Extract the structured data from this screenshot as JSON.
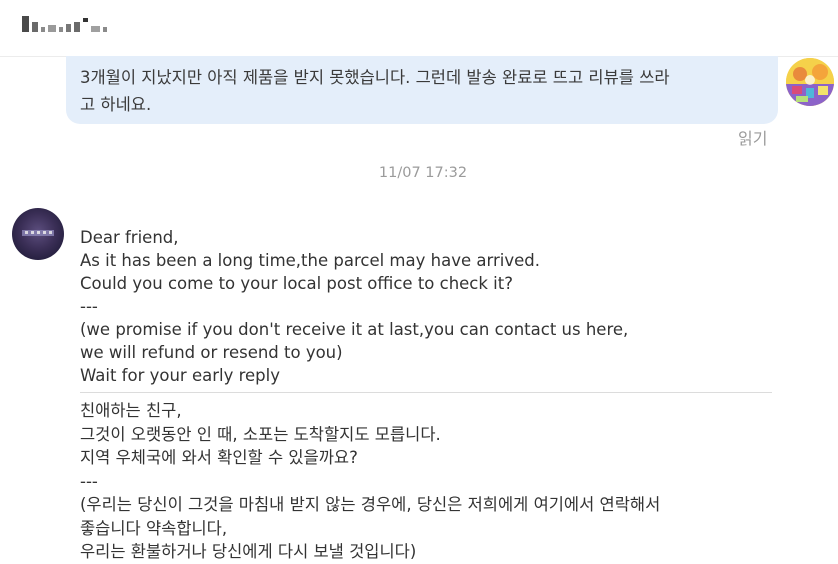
{
  "header": {
    "title_blurred": true
  },
  "outgoing_message": {
    "line1": "3개월이 지났지만 아직 제품을 받지 못했습니다. 그런데 발송 완료로 뜨고 리뷰를 쓰라",
    "line2": "고 하네요.",
    "read_status": "읽기"
  },
  "timestamp": "11/07 17:32",
  "incoming_message": {
    "english_lines": [
      "Dear friend,",
      "As it has been a long time,the parcel may have arrived.",
      "Could you come to your local post office to check it?",
      "---",
      "(we promise if you don't receive it at last,you can contact us here,",
      "we will refund or resend to you)",
      "Wait for your early reply"
    ],
    "korean_lines": [
      "친애하는 친구,",
      "그것이 오랫동안 인 때, 소포는 도착할지도 모릅니다.",
      "지역 우체국에 와서 확인할 수 있을까요?",
      "---",
      "(우리는 당신이 그것을 마침내 받지 않는 경우에, 당신은 저희에게 여기에서 연락해서",
      "좋습니다 약속합니다,",
      "우리는 환불하거나 당신에게 다시 보낼 것입니다)"
    ]
  },
  "colors": {
    "outgoing_bubble": "#e4eefa",
    "meta_text": "#9b9b9b",
    "body_text": "#333333"
  },
  "icons": {
    "self_avatar": "self-avatar-image",
    "partner_avatar": "partner-avatar-image"
  }
}
